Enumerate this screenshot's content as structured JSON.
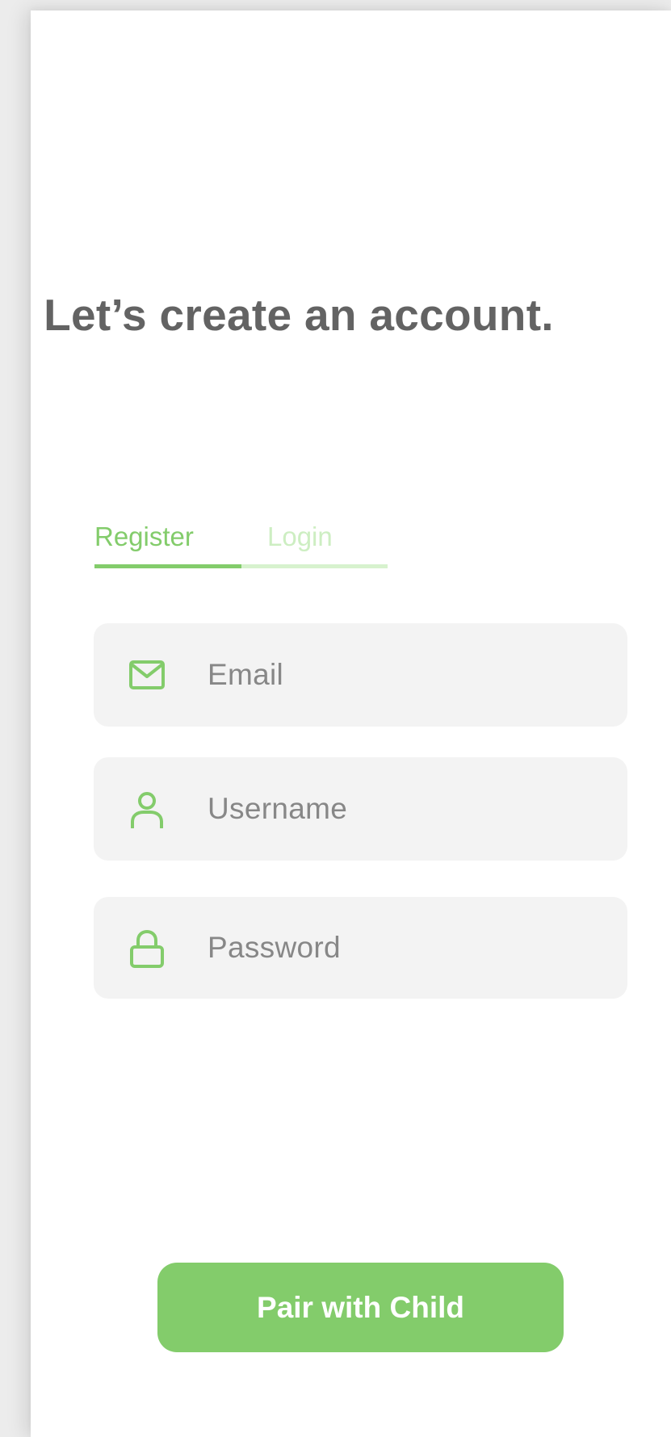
{
  "header": {
    "title": "Let’s create an account."
  },
  "tabs": {
    "items": [
      {
        "label": "Register",
        "active": true
      },
      {
        "label": "Login",
        "active": false
      }
    ]
  },
  "form": {
    "email": {
      "placeholder": "Email",
      "value": "",
      "icon": "mail-icon"
    },
    "username": {
      "placeholder": "Username",
      "value": "",
      "icon": "user-icon"
    },
    "password": {
      "placeholder": "Password",
      "value": "",
      "icon": "lock-icon"
    }
  },
  "actions": {
    "primary_label": "Pair with Child"
  },
  "colors": {
    "accent": "#83cc6b",
    "accent_light": "#cdeec2",
    "title": "#636363",
    "field_bg": "#f3f3f3",
    "placeholder": "#878787"
  }
}
